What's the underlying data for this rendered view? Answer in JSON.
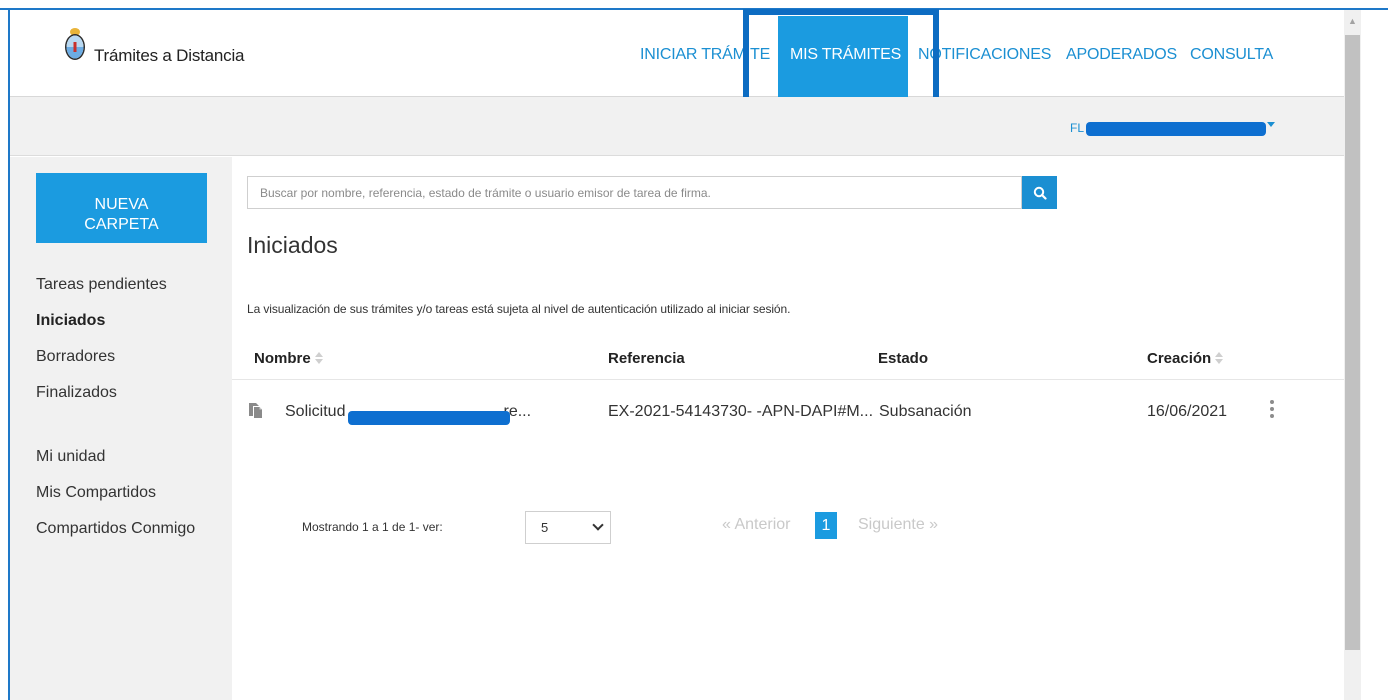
{
  "header": {
    "brand": "Trámites a Distancia",
    "nav": [
      {
        "label": "INICIAR TRÁMITE"
      },
      {
        "label": "MIS TRÁMITES",
        "active": true
      },
      {
        "label": "NOTIFICACIONES"
      },
      {
        "label": "APODERADOS"
      },
      {
        "label": "CONSULTA"
      }
    ]
  },
  "user_menu": {
    "visible_prefix": "FL"
  },
  "sidebar": {
    "new_folder_line1": "NUEVA",
    "new_folder_line2": "CARPETA",
    "links": [
      {
        "label": "Tareas pendientes",
        "active": false
      },
      {
        "label": "Iniciados",
        "active": true
      },
      {
        "label": "Borradores",
        "active": false
      },
      {
        "label": "Finalizados",
        "active": false
      },
      {
        "label": "Mi unidad",
        "active": false
      },
      {
        "label": "Mis Compartidos",
        "active": false
      },
      {
        "label": "Compartidos Conmigo",
        "active": false
      }
    ]
  },
  "search": {
    "placeholder": "Buscar por nombre, referencia, estado de trámite o usuario emisor de tarea de firma."
  },
  "main": {
    "title": "Iniciados",
    "notice": "La visualización de sus trámites y/o tareas está sujeta al nivel de autenticación utilizado al iniciar sesión."
  },
  "table": {
    "columns": [
      "Nombre",
      "Referencia",
      "Estado",
      "Creación"
    ],
    "rows": [
      {
        "nombre_start": "Solicitud",
        "nombre_end": "re...",
        "referencia": "EX-2021-54143730- -APN-DAPI#M...",
        "estado": "Subsanación",
        "creacion": "16/06/2021"
      }
    ]
  },
  "pagination": {
    "showing": "Mostrando 1 a 1 de 1- ver:",
    "page_size": "5",
    "prev": "« Anterior",
    "current": "1",
    "next": "Siguiente »"
  },
  "colors": {
    "accent": "#1b9be0",
    "link": "#1b8fd2",
    "highlight_box": "#0d6cc2"
  }
}
